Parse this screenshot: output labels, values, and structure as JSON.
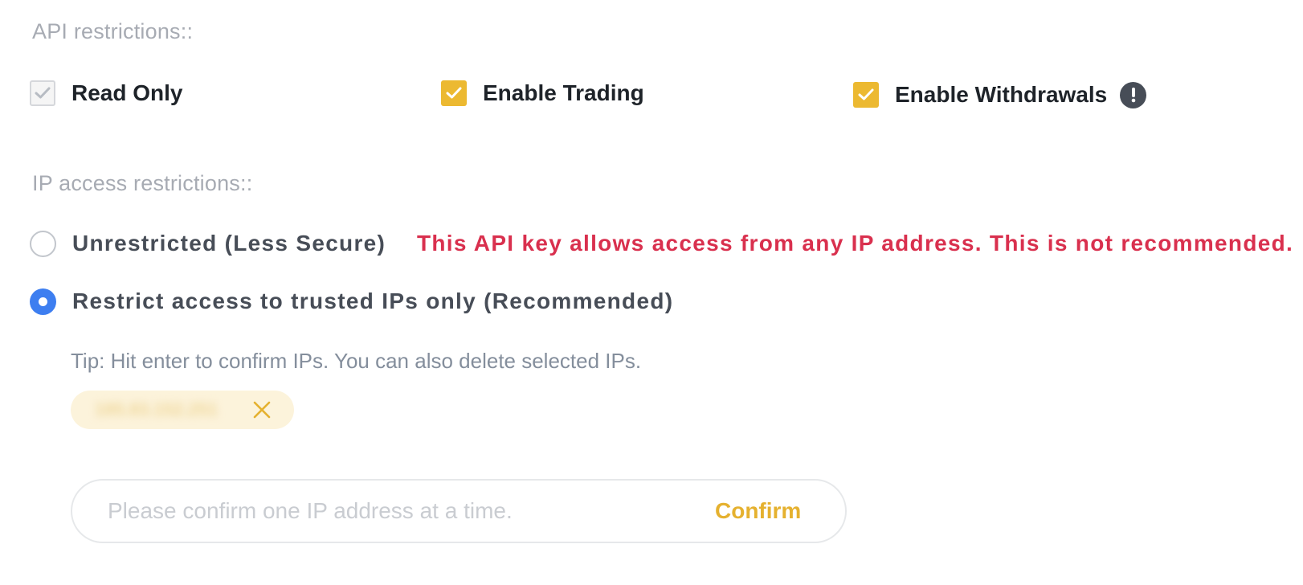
{
  "api_restrictions": {
    "label": "API restrictions::",
    "options": [
      {
        "label": "Read Only",
        "checked": true,
        "disabled": true
      },
      {
        "label": "Enable Trading",
        "checked": true,
        "disabled": false
      },
      {
        "label": "Enable Withdrawals",
        "checked": true,
        "disabled": false
      }
    ]
  },
  "ip_restrictions": {
    "label": "IP access restrictions::",
    "unrestricted": {
      "label": "Unrestricted (Less Secure)",
      "selected": false,
      "warning": "This API key allows access from any IP address. This is not recommended."
    },
    "restricted": {
      "label": "Restrict access to trusted IPs only (Recommended)",
      "selected": true
    },
    "tip": "Tip: Hit enter to confirm IPs. You can also delete selected IPs.",
    "tags": [
      {
        "value": "185.83.152.251"
      }
    ],
    "input": {
      "value": "",
      "placeholder": "Please confirm one IP address at a time."
    },
    "confirm_label": "Confirm"
  },
  "colors": {
    "accent": "#ecb931",
    "warning": "#d9304e",
    "radio_selected": "#3d7ef0"
  },
  "icons": {
    "checkmark": "check-icon",
    "warning": "exclamation-circle-icon",
    "remove": "close-icon"
  }
}
